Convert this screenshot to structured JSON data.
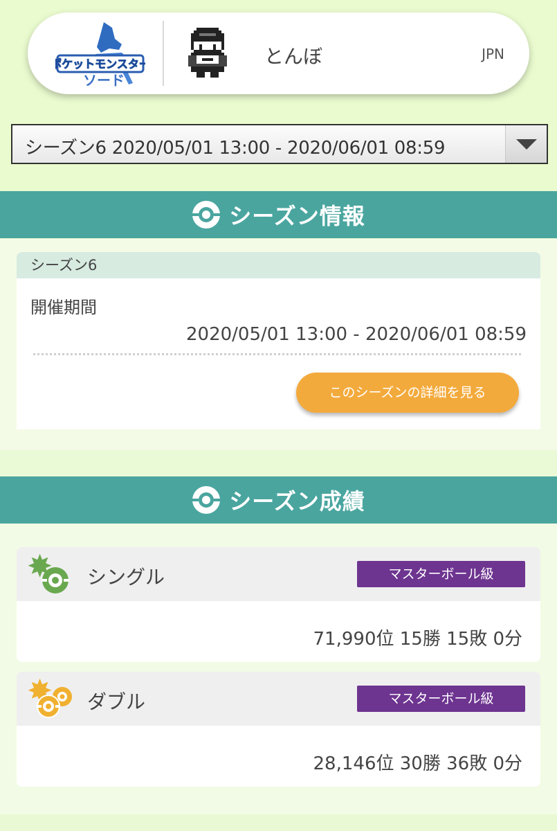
{
  "header": {
    "game_logo": {
      "line1": "ポケットモンスター",
      "line2": "ソード",
      "accent": "#3a6fc4"
    },
    "player_name": "とんぼ",
    "region": "JPN"
  },
  "season_select": {
    "selected": "シーズン6 2020/05/01 13:00 - 2020/06/01 08:59"
  },
  "season_info": {
    "section_title": "シーズン情報",
    "season_label": "シーズン6",
    "period_label": "開催期間",
    "period_value": "2020/05/01 13:00 - 2020/06/01 08:59",
    "detail_button": "このシーズンの詳細を見る"
  },
  "season_results": {
    "section_title": "シーズン成績",
    "single": {
      "label": "シングル",
      "rank_class": "マスターボール級",
      "record": "71,990位 15勝 15敗 0分"
    },
    "double": {
      "label": "ダブル",
      "rank_class": "マスターボール級",
      "record": "28,146位 30勝 36敗 0分"
    }
  },
  "colors": {
    "section_bar": "#4aa59f",
    "button": "#f3aa3c",
    "badge": "#6d3490",
    "single_icon": "#6aa84f",
    "double_icon": "#f0b030"
  }
}
